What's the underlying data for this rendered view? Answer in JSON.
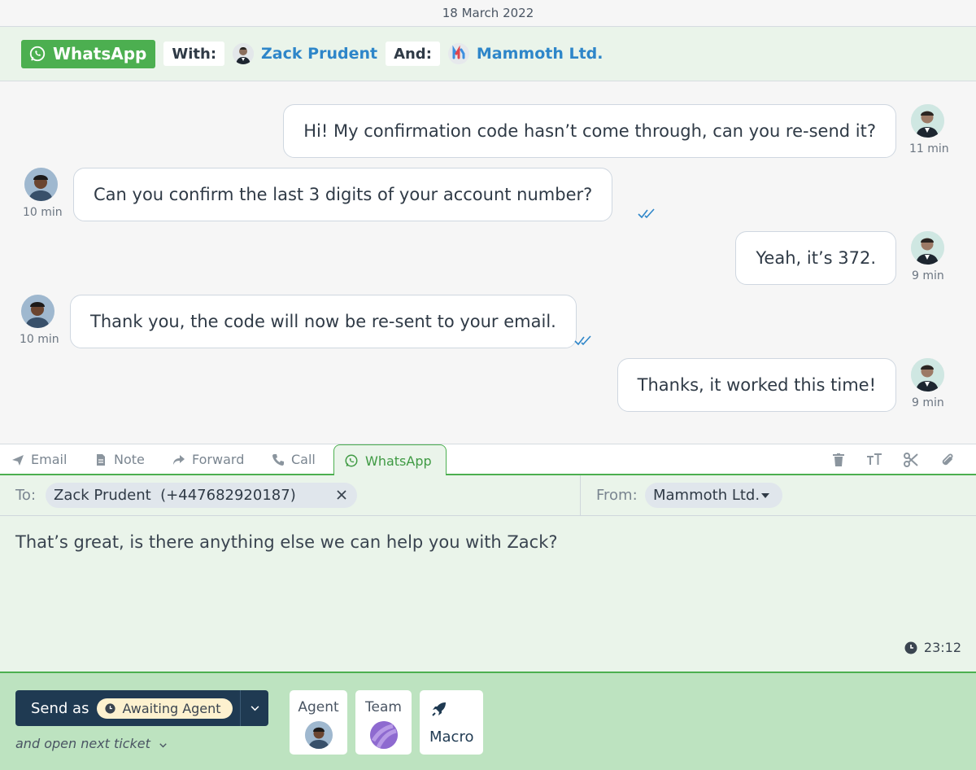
{
  "date_bar": {
    "text": "18 March 2022"
  },
  "header": {
    "channel": "WhatsApp",
    "with_label": "With:",
    "contact_name": "Zack Prudent",
    "and_label": "And:",
    "company_name": "Mammoth Ltd."
  },
  "messages": [
    {
      "side": "right",
      "text": "Hi! My confirmation code hasn’t come through, can you re-send it?",
      "time": "11 min"
    },
    {
      "side": "left",
      "text": "Can you confirm the last 3 digits of your account number?",
      "time": "10 min"
    },
    {
      "side": "right",
      "text": "Yeah, it’s 372.",
      "time": "9 min"
    },
    {
      "side": "left",
      "text": "Thank you, the code will now be re-sent to your email.",
      "time": "10 min"
    },
    {
      "side": "right",
      "text": "Thanks, it worked this time!",
      "time": "9 min"
    }
  ],
  "tabs": [
    {
      "label": "Email",
      "icon": "send-icon"
    },
    {
      "label": "Note",
      "icon": "note-icon"
    },
    {
      "label": "Forward",
      "icon": "forward-icon"
    },
    {
      "label": "Call",
      "icon": "phone-icon"
    },
    {
      "label": "WhatsApp",
      "icon": "whatsapp-icon",
      "active": true
    }
  ],
  "toolbar_icons": [
    "trash-icon",
    "text-size-icon",
    "scissors-icon",
    "paperclip-icon"
  ],
  "compose": {
    "to_label": "To:",
    "to_chip": "Zack Prudent  (+447682920187)",
    "from_label": "From:",
    "from_value": "Mammoth Ltd.",
    "body": "That’s great, is there anything else we can help you with Zack?",
    "time": "23:12"
  },
  "footer": {
    "send_label": "Send as",
    "status": "Awaiting Agent",
    "open_next": "and open next ticket",
    "agent_label": "Agent",
    "team_label": "Team",
    "macro_label": "Macro"
  },
  "colors": {
    "whatsapp_green": "#4caf50",
    "link_blue": "#2e86c9",
    "navy": "#1f3a52",
    "footer_green": "#bde3c0",
    "compose_bg": "#eaf4ea"
  }
}
